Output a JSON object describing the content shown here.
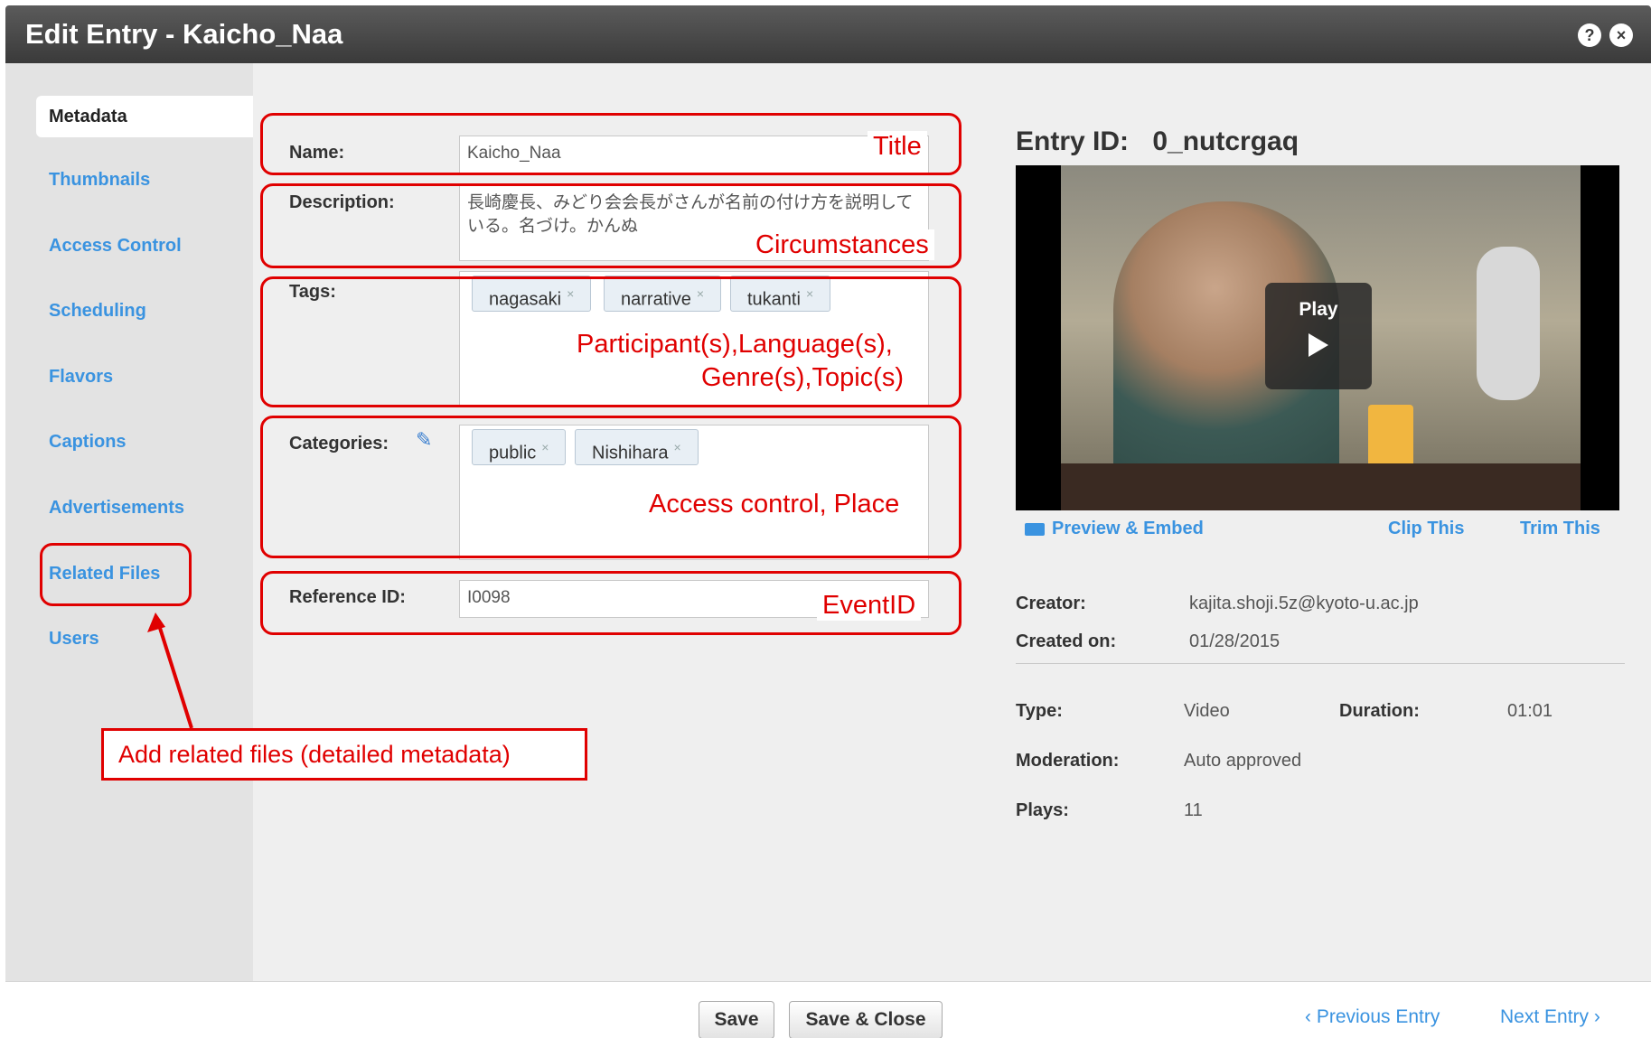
{
  "window": {
    "title": "Edit Entry - Kaicho_Naa",
    "help_icon": "?",
    "close_icon": "×"
  },
  "sidebar": {
    "items": [
      {
        "label": "Metadata"
      },
      {
        "label": "Thumbnails"
      },
      {
        "label": "Access Control"
      },
      {
        "label": "Scheduling"
      },
      {
        "label": "Flavors"
      },
      {
        "label": "Captions"
      },
      {
        "label": "Advertisements"
      },
      {
        "label": "Related Files"
      },
      {
        "label": "Users"
      }
    ]
  },
  "form": {
    "name_label": "Name:",
    "name_value": "Kaicho_Naa",
    "description_label": "Description:",
    "description_value": "長崎慶長、みどり会会長がさんが名前の付け方を説明している。名づけ。かんぬ",
    "tags_label": "Tags:",
    "tags": [
      "nagasaki",
      "narrative",
      "tukanti"
    ],
    "categories_label": "Categories:",
    "categories": [
      "public",
      "Nishihara"
    ],
    "reference_label": "Reference ID:",
    "reference_value": "I0098"
  },
  "annotations": {
    "title": "Title",
    "circumstances": "Circumstances",
    "tags_line1": "Participant(s),Language(s),",
    "tags_line2": "Genre(s),Topic(s)",
    "categories": "Access control, Place",
    "eventid": "EventID",
    "related": "Add related files   (detailed metadata)"
  },
  "entry": {
    "id_label": "Entry ID:",
    "id_value": "0_nutcrgaq",
    "play_label": "Play",
    "preview_embed": "Preview & Embed",
    "clip_this": "Clip This",
    "trim_this": "Trim This",
    "creator_label": "Creator:",
    "creator_value": "kajita.shoji.5z@kyoto-u.ac.jp",
    "created_label": "Created on:",
    "created_value": "01/28/2015",
    "type_label": "Type:",
    "type_value": "Video",
    "duration_label": "Duration:",
    "duration_value": "01:01",
    "moderation_label": "Moderation:",
    "moderation_value": "Auto approved",
    "plays_label": "Plays:",
    "plays_value": "11"
  },
  "footer": {
    "save": "Save",
    "save_close": "Save & Close",
    "previous": "‹ Previous Entry",
    "next": "Next Entry ›"
  },
  "colors": {
    "annotation": "#e00000",
    "link": "#3a93e0",
    "titlebar": "#4a4a4a"
  }
}
